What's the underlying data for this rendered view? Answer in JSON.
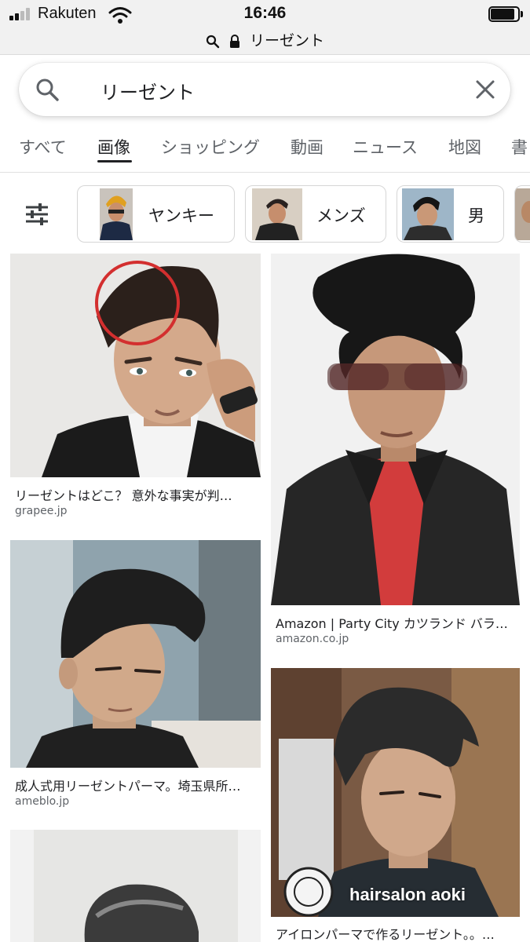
{
  "status_bar": {
    "carrier": "Rakuten",
    "time": "16:46",
    "url": "リーゼント"
  },
  "search": {
    "query": "リーゼント"
  },
  "tabs": [
    {
      "label": "すべて"
    },
    {
      "label": "画像",
      "active": true
    },
    {
      "label": "ショッピング"
    },
    {
      "label": "動画"
    },
    {
      "label": "ニュース"
    },
    {
      "label": "地図"
    },
    {
      "label": "書"
    }
  ],
  "chips": [
    {
      "label": "ヤンキー"
    },
    {
      "label": "メンズ"
    },
    {
      "label": "男"
    }
  ],
  "results": [
    {
      "title": "リーゼントはどこ？ 意外な事実が判…",
      "source": "grapee.jp"
    },
    {
      "title": "Amazon | Party City カツランド バラ…",
      "source": "amazon.co.jp"
    },
    {
      "title": "成人式用リーゼントパーマ。埼玉県所…",
      "source": "ameblo.jp"
    },
    {
      "title": "アイロンパーマで作るリーゼント。。…",
      "source": "",
      "watermark": "hairsalon aoki"
    },
    {
      "title": "",
      "source": ""
    }
  ],
  "colors": {
    "accent": "#202124",
    "secondary_text": "#5f6368",
    "annotation_circle": "#d32f2f"
  }
}
